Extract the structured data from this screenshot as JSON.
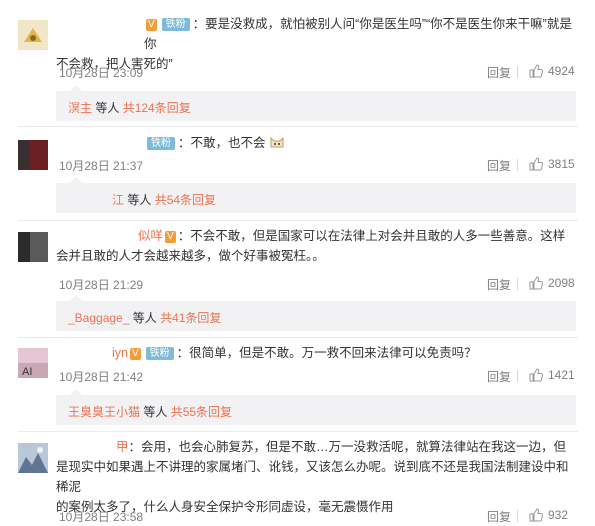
{
  "comments": [
    {
      "vip": "V",
      "fan_badge": "铁粉",
      "line1": "：要是没救成，就怕被别人问“你是医生吗”“你不是医生你来干嘛”就是你",
      "line2": "不会救，把人害死的”",
      "time": "10月28日 23:09",
      "reply": "回复",
      "likes": "4924",
      "sub_user": "溟主",
      "sub_mid": " 等人 ",
      "sub_count": "共124条回复"
    },
    {
      "fan_badge": "铁粉",
      "line1": "：不敢，也不会",
      "time": "10月28日 21:37",
      "reply": "回复",
      "likes": "3815",
      "sub_user": "江",
      "sub_mid": " 等人 ",
      "sub_count": "共54条回复"
    },
    {
      "user_tail": "似咩",
      "vip": "V",
      "line1": "：不会不敢，但是国家可以在法律上对会并且敢的人多一些善意。这样",
      "line2": "会并且敢的人才会越来越多，做个好事被冤枉。。",
      "time": "10月28日 21:29",
      "reply": "回复",
      "likes": "2098",
      "sub_user": "_Baggage_",
      "sub_mid": " 等人 ",
      "sub_count": "共41条回复"
    },
    {
      "user_tail": "iyn",
      "vip": "V",
      "fan_badge": "铁粉",
      "line1": "：很简单，但是不敢。万一救不回来法律可以免责吗？",
      "time": "10月28日 21:42",
      "reply": "回复",
      "likes": "1421",
      "sub_user": "王臭臭王小猫",
      "sub_mid": " 等人 ",
      "sub_count": "共55条回复"
    },
    {
      "user_tail": "甲",
      "line1": "：会用，也会心肺复苏，但是不敢…万一没救活呢，就算法律站在我这一边，但",
      "line2": "是现实中如果遇上不讲理的家属堵门、讹钱，又该怎么办呢。说到底不还是我国法制建设中和稀泥",
      "line3": "的案例太多了，什么人身安全保护令形同虚设，毫无震慑作用",
      "time": "10月28日 23:58",
      "reply": "回复",
      "likes": "932"
    }
  ],
  "colors": {
    "link": "#eb7350",
    "meta": "#808080",
    "reply_bg": "#f2f2f5"
  },
  "icons": {
    "like": "thumbs-up-icon"
  }
}
